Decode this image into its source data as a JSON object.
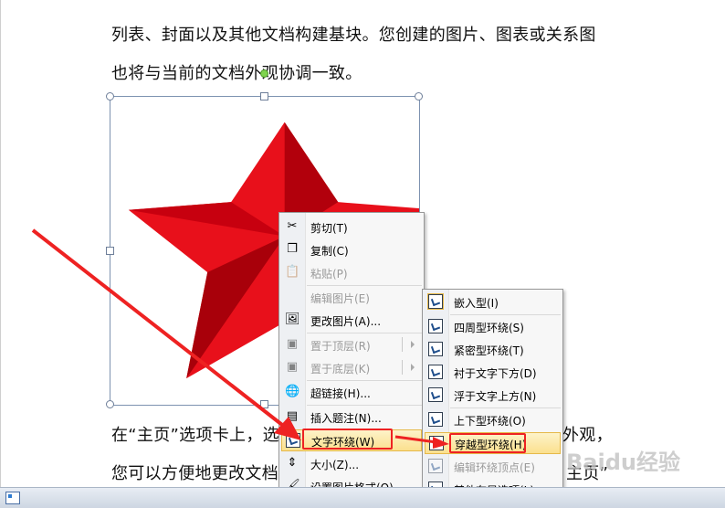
{
  "document": {
    "line1": "列表、封面以及其他文档构建基块。您创建的图片、图表或关系图",
    "line2": "也将与当前的文档外观协调一致。",
    "line3": "在“主页”选项卡上，选",
    "line4": "您可以方便地更改文档",
    "line3_tail": "外观，",
    "line4_tail": "主页”"
  },
  "context_menu": {
    "items": [
      {
        "label": "剪切(T)",
        "icon": "scissors-icon",
        "enabled": true
      },
      {
        "label": "复制(C)",
        "icon": "copy-icon",
        "enabled": true
      },
      {
        "label": "粘贴(P)",
        "icon": "paste-icon",
        "enabled": false
      },
      {
        "label": "编辑图片(E)",
        "icon": "",
        "enabled": false
      },
      {
        "label": "更改图片(A)...",
        "icon": "change-picture-icon",
        "enabled": true
      },
      {
        "label": "置于顶层(R)",
        "icon": "bring-front-icon",
        "enabled": false
      },
      {
        "label": "置于底层(K)",
        "icon": "send-back-icon",
        "enabled": false
      },
      {
        "label": "超链接(H)...",
        "icon": "hyperlink-icon",
        "enabled": true
      },
      {
        "label": "插入题注(N)...",
        "icon": "caption-icon",
        "enabled": true
      },
      {
        "label": "文字环绕(W)",
        "icon": "text-wrap-icon",
        "enabled": true
      },
      {
        "label": "大小(Z)...",
        "icon": "size-icon",
        "enabled": true
      },
      {
        "label": "设置图片格式(O)...",
        "icon": "format-picture-icon",
        "enabled": true
      }
    ]
  },
  "wrap_submenu": {
    "items": [
      {
        "label": "嵌入型(I)",
        "enabled": true
      },
      {
        "label": "四周型环绕(S)",
        "enabled": true
      },
      {
        "label": "紧密型环绕(T)",
        "enabled": true
      },
      {
        "label": "衬于文字下方(D)",
        "enabled": true
      },
      {
        "label": "浮于文字上方(N)",
        "enabled": true
      },
      {
        "label": "上下型环绕(O)",
        "enabled": true
      },
      {
        "label": "穿越型环绕(H)",
        "enabled": true
      },
      {
        "label": "编辑环绕顶点(E)",
        "enabled": false
      },
      {
        "label": "其他布局选项(L)...",
        "enabled": true
      }
    ]
  },
  "watermark": "Baidu经验",
  "colors": {
    "star_light": "#e8101b",
    "star_dark": "#b2000c",
    "annotation": "#ee2222",
    "hover": "#fbe08e"
  }
}
